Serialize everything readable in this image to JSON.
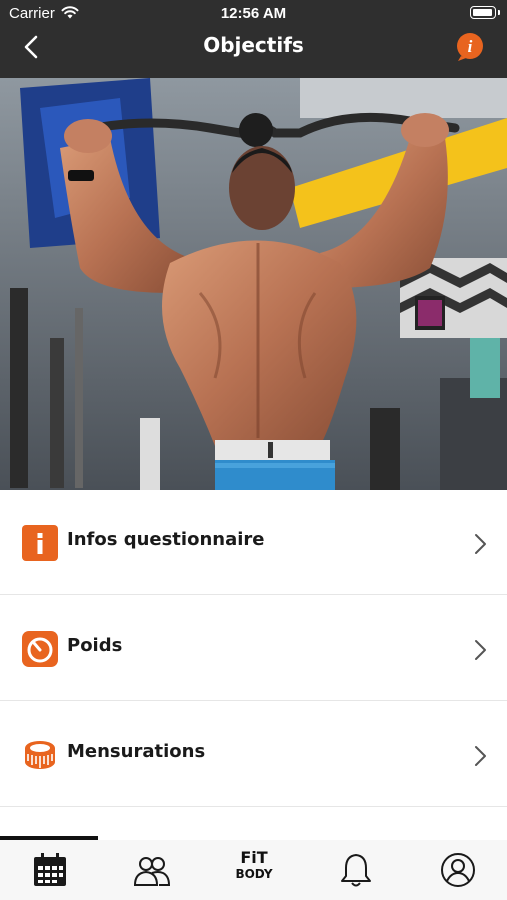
{
  "status_bar": {
    "carrier": "Carrier",
    "time": "12:56 AM"
  },
  "header": {
    "title": "Objectifs"
  },
  "menu": [
    {
      "label": "Infos questionnaire",
      "icon": "info-icon"
    },
    {
      "label": "Poids",
      "icon": "scale-icon"
    },
    {
      "label": "Mensurations",
      "icon": "tape-measure-icon"
    }
  ],
  "tabbar": {
    "brand_line1": "FiT",
    "brand_line2": "BODY",
    "tabs": [
      "calendar-icon",
      "community-icon",
      "fitbody-logo",
      "bell-icon",
      "profile-icon"
    ]
  },
  "colors": {
    "accent": "#e8641f",
    "header_bg": "#2f2f2f",
    "hero_highlight": "#f4c21b"
  }
}
